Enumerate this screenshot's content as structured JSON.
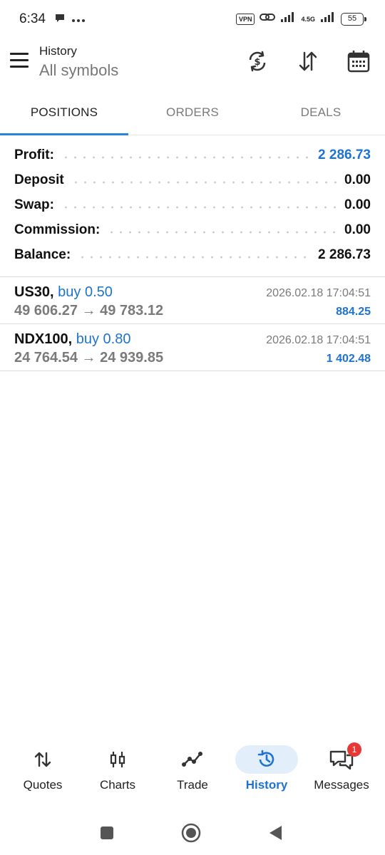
{
  "status_bar": {
    "time": "6:34",
    "vpn": "VPN",
    "network": "4.5G",
    "battery": "55"
  },
  "app_bar": {
    "title": "History",
    "subtitle": "All symbols"
  },
  "tabs": [
    {
      "label": "POSITIONS",
      "active": true
    },
    {
      "label": "ORDERS",
      "active": false
    },
    {
      "label": "DEALS",
      "active": false
    }
  ],
  "summary": {
    "profit": {
      "label": "Profit:",
      "value": "2 286.73"
    },
    "deposit": {
      "label": "Deposit",
      "value": "0.00"
    },
    "swap": {
      "label": "Swap:",
      "value": "0.00"
    },
    "commission": {
      "label": "Commission:",
      "value": "0.00"
    },
    "balance": {
      "label": "Balance:",
      "value": "2 286.73"
    }
  },
  "positions": [
    {
      "symbol": "US30,",
      "side": "buy 0.50",
      "open_price": "49 606.27",
      "arrow": "→",
      "close_price": "49 783.12",
      "time": "2026.02.18 17:04:51",
      "profit": "884.25"
    },
    {
      "symbol": "NDX100,",
      "side": "buy 0.80",
      "open_price": "24 764.54",
      "arrow": "→",
      "close_price": "24 939.85",
      "time": "2026.02.18 17:04:51",
      "profit": "1 402.48"
    }
  ],
  "bottom_nav": [
    {
      "label": "Quotes",
      "icon": "quotes-arrows-icon"
    },
    {
      "label": "Charts",
      "icon": "candlestick-icon"
    },
    {
      "label": "Trade",
      "icon": "trade-line-icon"
    },
    {
      "label": "History",
      "icon": "history-clock-icon",
      "active": true
    },
    {
      "label": "Messages",
      "icon": "messages-icon",
      "badge": "1"
    }
  ],
  "colors": {
    "accent": "#1e73d0",
    "tab_indicator": "#2d82d6",
    "active_nav_bg": "#e3eefb",
    "badge": "#e53935"
  }
}
